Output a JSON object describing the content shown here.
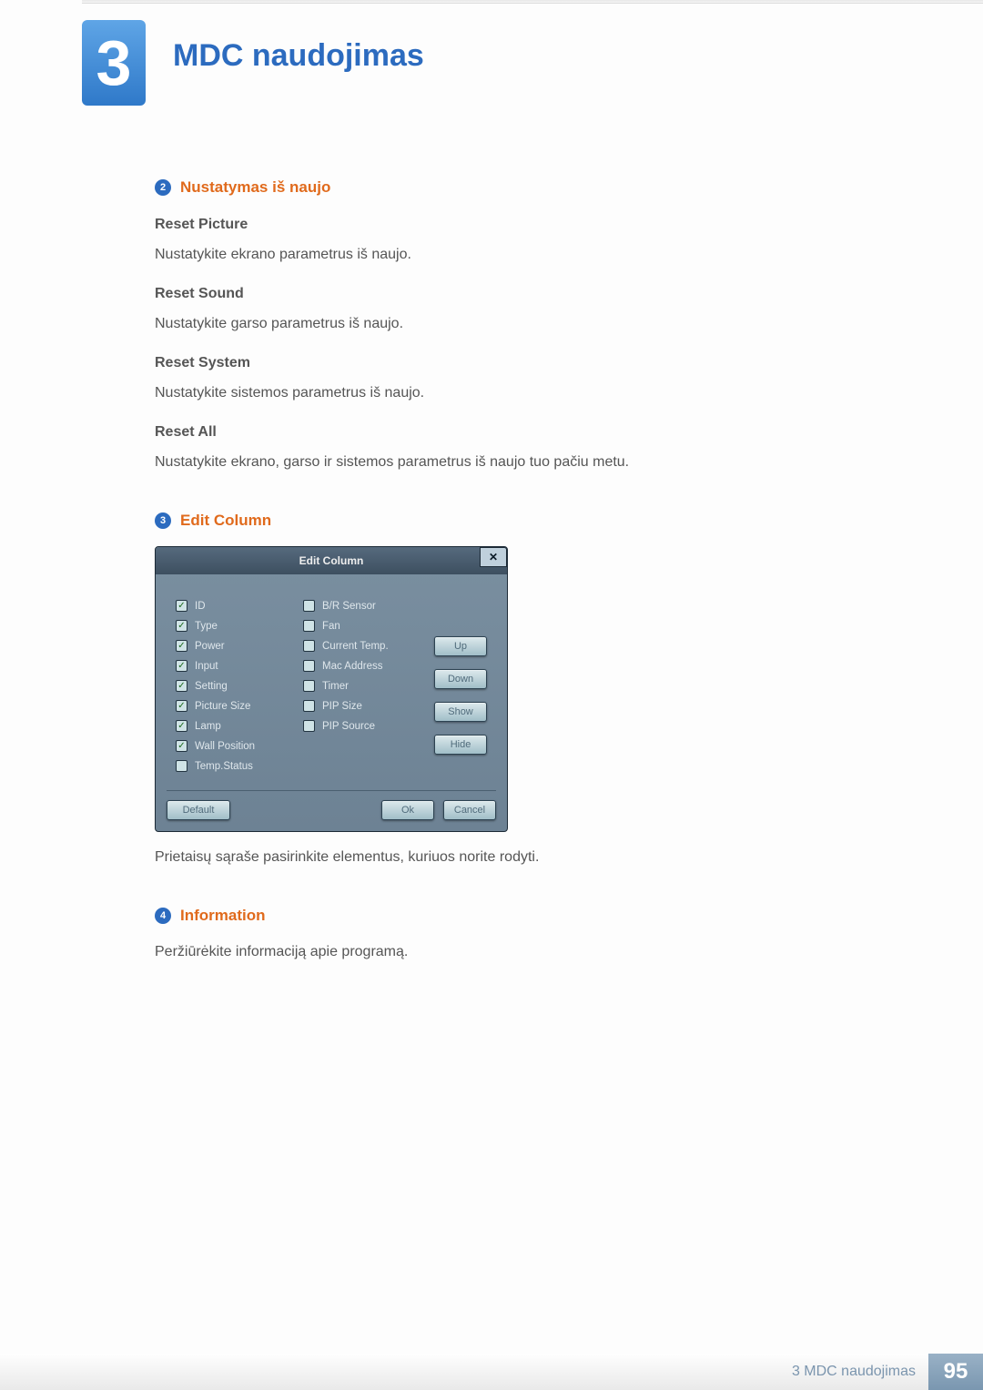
{
  "chapter": {
    "number": "3",
    "title": "MDC naudojimas"
  },
  "section2": {
    "badge": "2",
    "title": "Nustatymas iš naujo",
    "items": [
      {
        "heading": "Reset Picture",
        "text": "Nustatykite ekrano parametrus iš naujo."
      },
      {
        "heading": "Reset Sound",
        "text": "Nustatykite garso parametrus iš naujo."
      },
      {
        "heading": "Reset System",
        "text": "Nustatykite sistemos parametrus iš naujo."
      },
      {
        "heading": "Reset All",
        "text": "Nustatykite ekrano, garso ir sistemos parametrus iš naujo tuo pačiu metu."
      }
    ]
  },
  "section3": {
    "badge": "3",
    "title": "Edit Column",
    "dialog": {
      "title": "Edit Column",
      "close": "✕",
      "leftColumn": [
        {
          "label": "ID",
          "checked": true
        },
        {
          "label": "Type",
          "checked": true
        },
        {
          "label": "Power",
          "checked": true
        },
        {
          "label": "Input",
          "checked": true
        },
        {
          "label": "Setting",
          "checked": true
        },
        {
          "label": "Picture Size",
          "checked": true
        },
        {
          "label": "Lamp",
          "checked": true
        },
        {
          "label": "Wall Position",
          "checked": true
        },
        {
          "label": "Temp.Status",
          "checked": false
        }
      ],
      "midColumn": [
        {
          "label": "B/R Sensor",
          "checked": false
        },
        {
          "label": "Fan",
          "checked": false
        },
        {
          "label": "Current Temp.",
          "checked": false
        },
        {
          "label": "Mac Address",
          "checked": false
        },
        {
          "label": "Timer",
          "checked": false
        },
        {
          "label": "PIP Size",
          "checked": false
        },
        {
          "label": "PIP Source",
          "checked": false
        }
      ],
      "sideButtons": {
        "up": "Up",
        "down": "Down",
        "show": "Show",
        "hide": "Hide"
      },
      "footer": {
        "default": "Default",
        "ok": "Ok",
        "cancel": "Cancel"
      }
    },
    "caption": "Prietaisų sąraše pasirinkite elementus, kuriuos norite rodyti."
  },
  "section4": {
    "badge": "4",
    "title": "Information",
    "text": "Peržiūrėkite informaciją apie programą."
  },
  "footer": {
    "text": "3 MDC naudojimas",
    "page": "95"
  }
}
